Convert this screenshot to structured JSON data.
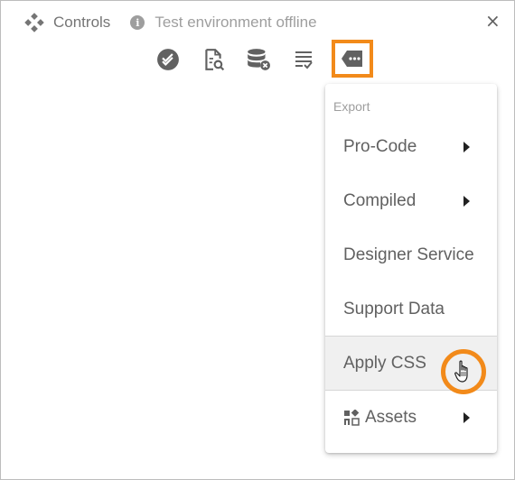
{
  "header": {
    "title": "Controls",
    "status": "Test environment offline",
    "info_icon": "i",
    "close_label": "×"
  },
  "toolbar": {
    "items": [
      {
        "name": "validate-icon"
      },
      {
        "name": "search-document-icon"
      },
      {
        "name": "database-remove-icon"
      },
      {
        "name": "list-check-icon"
      },
      {
        "name": "more-tag-icon",
        "active": true
      }
    ]
  },
  "menu": {
    "header": "Export",
    "items": [
      {
        "label": "Pro-Code",
        "has_submenu": true
      },
      {
        "label": "Compiled",
        "has_submenu": true
      },
      {
        "label": "Designer Service",
        "has_submenu": false
      },
      {
        "label": "Support Data",
        "has_submenu": false
      },
      {
        "label": "Apply CSS",
        "has_submenu": false,
        "hovered": true
      },
      {
        "label": "Assets",
        "has_submenu": true,
        "icon": "assets-icon"
      }
    ]
  },
  "colors": {
    "accent": "#f28a1a",
    "icon": "#616161",
    "text": "#616161",
    "muted": "#9e9e9e"
  }
}
